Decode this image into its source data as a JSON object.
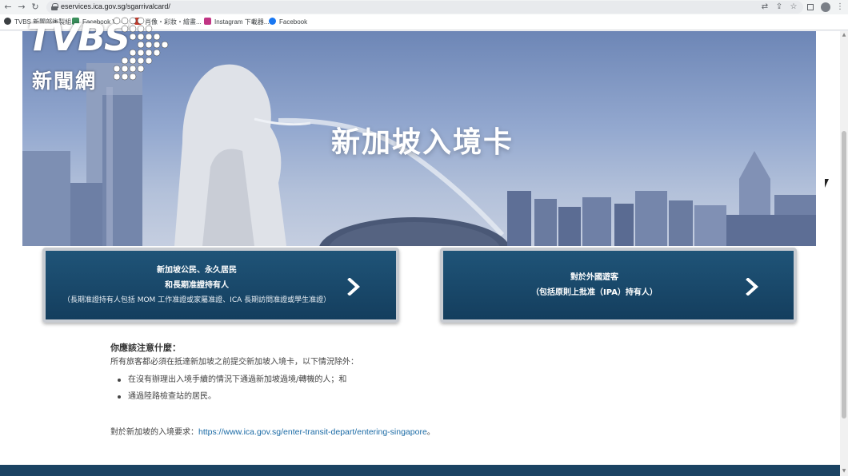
{
  "browser": {
    "url": "eservices.ica.gov.sg/sgarrivalcard/",
    "bookmarks": [
      {
        "label": "TVBS 新聞部後製組...",
        "icon": "tvbs-icon",
        "color": "#3c4043"
      },
      {
        "label": "Facebook Vi...",
        "icon": "facebook-square-icon",
        "color": "#3b8f5c"
      },
      {
        "label": "肖像・彩妝・繪畫...",
        "icon": "bookmark-icon",
        "color": "#c0392b"
      },
      {
        "label": "Instagram 下載器...",
        "icon": "instagram-icon",
        "color": "#c13584"
      },
      {
        "label": "Facebook",
        "icon": "facebook-icon",
        "color": "#1877f2"
      }
    ]
  },
  "watermark": {
    "brand": "TVBS",
    "subtitle": "新聞網"
  },
  "hero": {
    "title": "新加坡入境卡"
  },
  "cards": [
    {
      "line1": "新加坡公民、永久居民",
      "line2": "和長期准證持有人",
      "line3": "（長期准證持有人包括 MOM 工作准證或家屬准證、ICA 長期訪問准證或學生准證）"
    },
    {
      "line1": "對於外國遊客",
      "line2": "（包括原則上批准（IPA）持有人）",
      "line3": ""
    }
  ],
  "notes": {
    "title": "你應該注意什麼：",
    "intro": "所有旅客都必須在抵達新加坡之前提交新加坡入境卡，以下情況除外：",
    "exceptions": [
      "在沒有辦理出入境手續的情況下通過新加坡過境/轉機的人；和",
      "通過陸路檢查站的居民。"
    ],
    "requirements_label": "對於新加坡的入境要求：",
    "requirements_link": "https://www.ica.gov.sg/enter-transit-depart/entering-singapore",
    "requirements_suffix": "。"
  },
  "colors": {
    "card_bg": "#1b4a6d",
    "footer": "#1b4363",
    "link": "#1a6aa5"
  }
}
